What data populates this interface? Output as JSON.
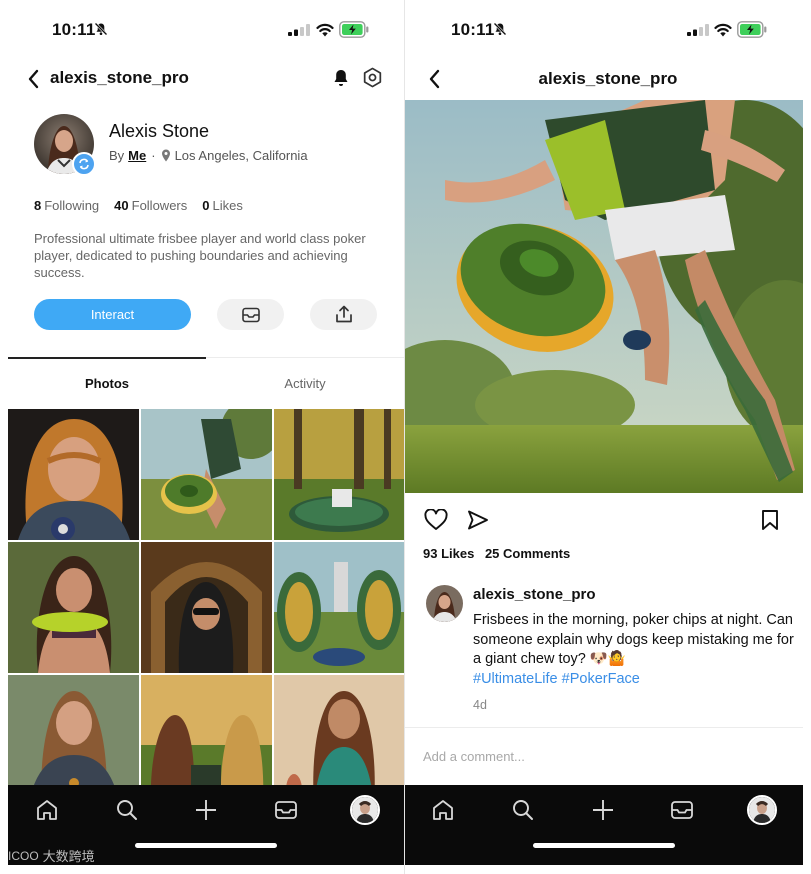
{
  "colors": {
    "accent": "#3fa9f5",
    "hashtag": "#3a8ee6",
    "tabbar": "#0a0a0a",
    "badge": "#4da3f0"
  },
  "status_bar": {
    "time": "10:11",
    "icons": [
      "bell-slash-icon",
      "cellular-signal-icon",
      "wifi-icon",
      "battery-charging-icon"
    ]
  },
  "profile": {
    "handle": "alexis_stone_pro",
    "name": "Alexis Stone",
    "by_label": "By",
    "by_value": "Me",
    "separator": "·",
    "location": "Los Angeles, California",
    "stats": [
      {
        "count": "8",
        "label": "Following"
      },
      {
        "count": "40",
        "label": "Followers"
      },
      {
        "count": "0",
        "label": "Likes"
      }
    ],
    "bio": "Professional ultimate frisbee player and world class poker player, dedicated to pushing boundaries and achieving success.",
    "interact_label": "Interact",
    "tabs": [
      {
        "label": "Photos",
        "active": true
      },
      {
        "label": "Activity",
        "active": false
      }
    ],
    "grid_count": 9
  },
  "post": {
    "header_title": "alexis_stone_pro",
    "likes": "93 Likes",
    "comments": "25 Comments",
    "author": "alexis_stone_pro",
    "caption": "Frisbees in the morning, poker chips at night. Can someone explain why dogs keep mistaking me for a giant chew toy? 🐶🤷",
    "hashtags": "#UltimateLife #PokerFace",
    "time_ago": "4d",
    "comment_placeholder": "Add a comment..."
  },
  "tabbar_icons": [
    "home-icon",
    "search-icon",
    "plus-icon",
    "inbox-icon",
    "profile-avatar"
  ],
  "watermark": {
    "mark": "ICOO",
    "text": "大数跨境"
  }
}
